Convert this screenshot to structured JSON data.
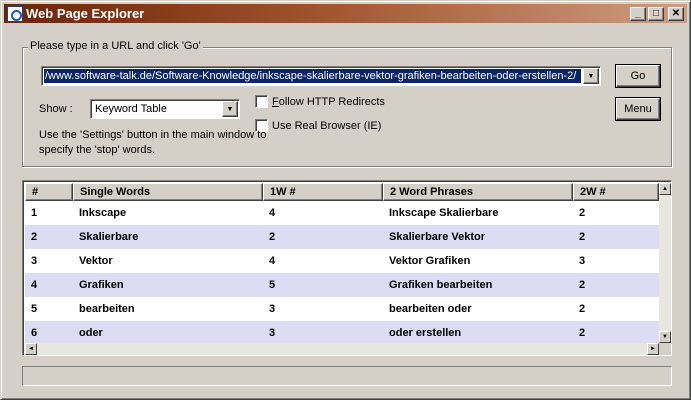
{
  "window": {
    "title": "Web Page Explorer"
  },
  "title_buttons": {
    "minimize": "_",
    "maximize": "□",
    "close": "✕"
  },
  "url_group": {
    "prompt": "Please type in a URL and click 'Go'",
    "url_value": "/www.software-talk.de/Software-Knowledge/inkscape-skalierbare-vektor-grafiken-bearbeiten-oder-erstellen-2/",
    "go_label": "Go",
    "menu_label": "Menu",
    "show_label": "Show :",
    "show_value": "Keyword Table",
    "follow_redirects_label": "Follow HTTP Redirects",
    "real_browser_label": "Use Real Browser (IE)",
    "help_text": "Use the 'Settings' button in the main window to specify the 'stop' words."
  },
  "table": {
    "columns": [
      "#",
      "Single Words",
      "1W #",
      "2 Word Phrases",
      "2W #"
    ],
    "rows": [
      [
        "1",
        "Inkscape",
        "4",
        "Inkscape Skalierbare",
        "2"
      ],
      [
        "2",
        "Skalierbare",
        "2",
        "Skalierbare Vektor",
        "2"
      ],
      [
        "3",
        "Vektor",
        "4",
        "Vektor Grafiken",
        "3"
      ],
      [
        "4",
        "Grafiken",
        "5",
        "Grafiken bearbeiten",
        "2"
      ],
      [
        "5",
        "bearbeiten",
        "3",
        "bearbeiten oder",
        "2"
      ],
      [
        "6",
        "oder",
        "3",
        "oder erstellen",
        "2"
      ]
    ]
  },
  "colors": {
    "title_start": "#6a2408",
    "selection": "#0a246a",
    "alt_row": "#dcdcf4"
  }
}
